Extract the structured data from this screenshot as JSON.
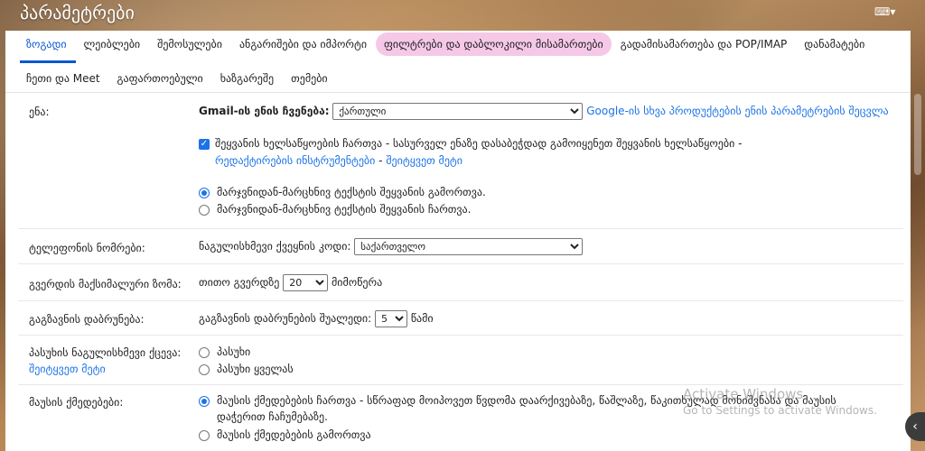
{
  "header": {
    "title": "პარამეტრები",
    "keyboard_icon": "keyboard-icon"
  },
  "tabs": {
    "row1": [
      "ზოგადი",
      "ლეიბლები",
      "შემოსულები",
      "ანგარიშები და იმპორტი",
      "ფილტრები და დაბლოკილი მისამართები",
      "გადამისამართება და POP/IMAP",
      "დანამატები"
    ],
    "row2": [
      "ჩეთი და Meet",
      "გაფართოებული",
      "ხაზგარეშე",
      "თემები"
    ],
    "active": "ზოგადი",
    "highlighted": "ფილტრები და დაბლოკილი მისამართები"
  },
  "language": {
    "label": "ენა:",
    "gmail_lang_label": "Gmail-ის ენის ჩვენება:",
    "gmail_lang_value": "ქართული",
    "other_products_link": "Google-ის სხვა პროდუქტების ენის პარამეტრების შეცვლა",
    "input_tools_checkbox": "შეყვანის ხელსაწყოების ჩართვა",
    "input_tools_desc": " - სასურველ ენაზე დასაბეჭდად გამოიყენეთ შეყვანის ხელსაწყოები -",
    "edit_tools_link": "რედაქტირების ინსტრუმენტები",
    "dash": " - ",
    "learn_more": "შეიტყვეთ მეტი",
    "rtl_off": "მარჯვნიდან-მარცხნივ ტექსტის შეყვანის გამორთვა.",
    "rtl_on": "მარჯვნიდან-მარცხნივ ტექსტის შეყვანის ჩართვა."
  },
  "phone": {
    "label": "ტელეფონის ნომრები:",
    "country_label": "ნაგულისხმევი ქვეყნის კოდი:",
    "country_value": "საქართველო"
  },
  "page_size": {
    "label": "გვერდის მაქსიმალური ზომა:",
    "prefix": "თითო გვერდზე",
    "value": "20",
    "suffix": "მიმოწერა"
  },
  "undo_send": {
    "label": "გაგზავნის დაბრუნება:",
    "prefix": "გაგზავნის დაბრუნების შუალედი:",
    "value": "5",
    "suffix": "წამი"
  },
  "reply": {
    "label": "პასუხის ნაგულისხმევი ქცევა:",
    "learn_more": "შეიტყვეთ მეტი",
    "opt1": "პასუხი",
    "opt2": "პასუხი ყველას"
  },
  "hover": {
    "label": "მაუსის ქმედებები:",
    "on_title": "მაუსის ქმედებების ჩართვა",
    "on_desc": " - სწრაფად მოიპოვეთ წვდომა დაარქივებაზე, წაშლაზე, წაკითხულად მონიშვნასა და მაუსის",
    "on_desc2": "დაჭერით ჩაჩუმებაზე.",
    "off": "მაუსის ქმედებების გამორთვა"
  },
  "watermark": {
    "line1": "Activate Windows",
    "line2": "Go to Settings to activate Windows."
  }
}
